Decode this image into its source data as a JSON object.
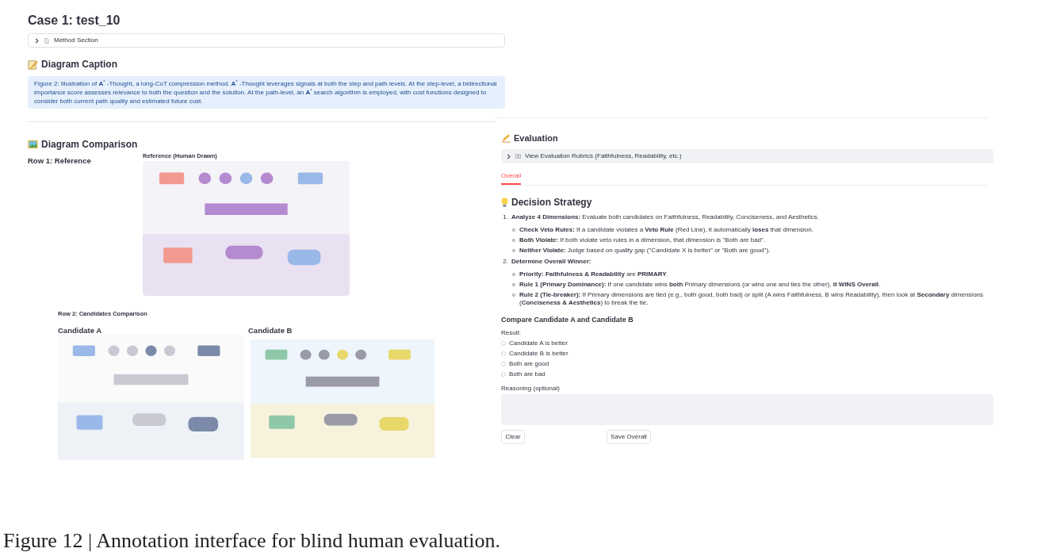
{
  "case_title": "Case 1: test_10",
  "method_expander": {
    "label": "Method Section",
    "expanded": false
  },
  "caption_heading": "Diagram Caption",
  "caption_text": "Figure 2: Illustration of **A**$^{*}$ -Thought, a long-CoT compression method. **A**$^{*}$ -Thought leverages signals at both the step and path levels. At the step-level, a bidirectional importance score assesses relevance to both the question and the solution. At the path-level, an **A**$^{*}$ search algorithm is employed, with cost functions designed to consider both current path quality and estimated future cost.",
  "comparison_heading": "Diagram Comparison",
  "row1_label": "Row 1: Reference",
  "reference_label": "Reference (Human Drawn)",
  "row2_label": "Row 2: Candidates Comparison",
  "candidates": [
    {
      "label": "Candidate A"
    },
    {
      "label": "Candidate B"
    }
  ],
  "evaluation": {
    "heading": "Evaluation",
    "rubrics_expander": {
      "label": "View Evaluation Rubrics (Faithfulness, Readability, etc.)",
      "expanded": false
    },
    "tabs": [
      {
        "label": "Overall",
        "selected": true
      }
    ],
    "strategy_heading": "Decision Strategy",
    "strategy": [
      {
        "marker": "1.",
        "text": "**Analyze 4 Dimensions:** Evaluate both candidates on Faithfulness, Readability, Conciseness, and Aesthetics.",
        "children": [
          {
            "text": "**Check Veto Rules:** If a candidate violates a **Veto Rule** (Red Line), it automatically **loses** that dimension."
          },
          {
            "text": "**Both Violate:** If both violate veto rules in a dimension, that dimension is \"Both are bad\"."
          },
          {
            "text": "**Neither Violate:** Judge based on quality gap (\"Candidate X is better\" or \"Both are good\")."
          }
        ]
      },
      {
        "marker": "2.",
        "text": "**Determine Overall Winner:**",
        "children": [
          {
            "text": "**Priority: Faithfulness & Readability** are **PRIMARY**."
          },
          {
            "text": "**Rule 1 (Primary Dominance):** If one candidate wins **both** Primary dimensions (or wins one and ties the other), **it WINS Overall**."
          },
          {
            "text": "**Rule 2 (Tie-breaker):** If Primary dimensions are tied (e.g., both good, both bad) or split (A wins Faithfulness, B wins Readability), then look at **Secondary** dimensions (**Conciseness & Aesthetics**) to break the tie."
          }
        ]
      }
    ],
    "compare_heading": "Compare Candidate A and Candidate B",
    "result_label": "Result:",
    "options": [
      {
        "label": "Candidate A is better",
        "selected": false
      },
      {
        "label": "Candidate B is better",
        "selected": false
      },
      {
        "label": "Both are good",
        "selected": false
      },
      {
        "label": "Both are bad",
        "selected": false
      }
    ],
    "reasoning_label": "Reasoning (optional)",
    "buttons": [
      {
        "kind": "clear",
        "label": "Clear"
      },
      {
        "kind": "save",
        "label": "Save Overall"
      }
    ]
  },
  "figure_caption": "Figure 12 | Annotation interface for blind human evaluation."
}
